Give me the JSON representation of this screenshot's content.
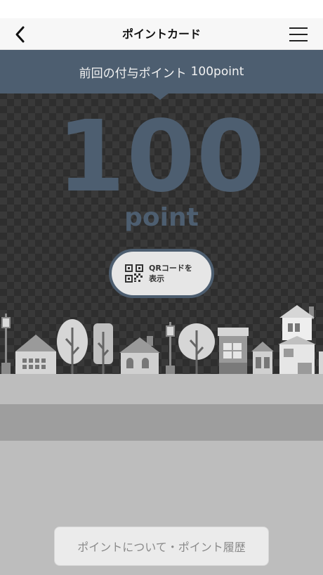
{
  "nav": {
    "title": "ポイントカード",
    "back_icon": "chevron-left-icon",
    "menu_icon": "hamburger-menu-icon"
  },
  "banner": {
    "label": "前回の付与ポイント",
    "value": "100point"
  },
  "points": {
    "value": "100",
    "unit": "point"
  },
  "qr_button": {
    "label": "QRコードを表示",
    "icon": "qr-code-icon"
  },
  "history_button": {
    "label": "ポイントについて・ポイント履歴"
  },
  "colors": {
    "accent": "#4d5e70",
    "hero_bg": "#2e2e2e",
    "road_light": "#bdbdbd",
    "road_dark": "#9e9e9e"
  }
}
